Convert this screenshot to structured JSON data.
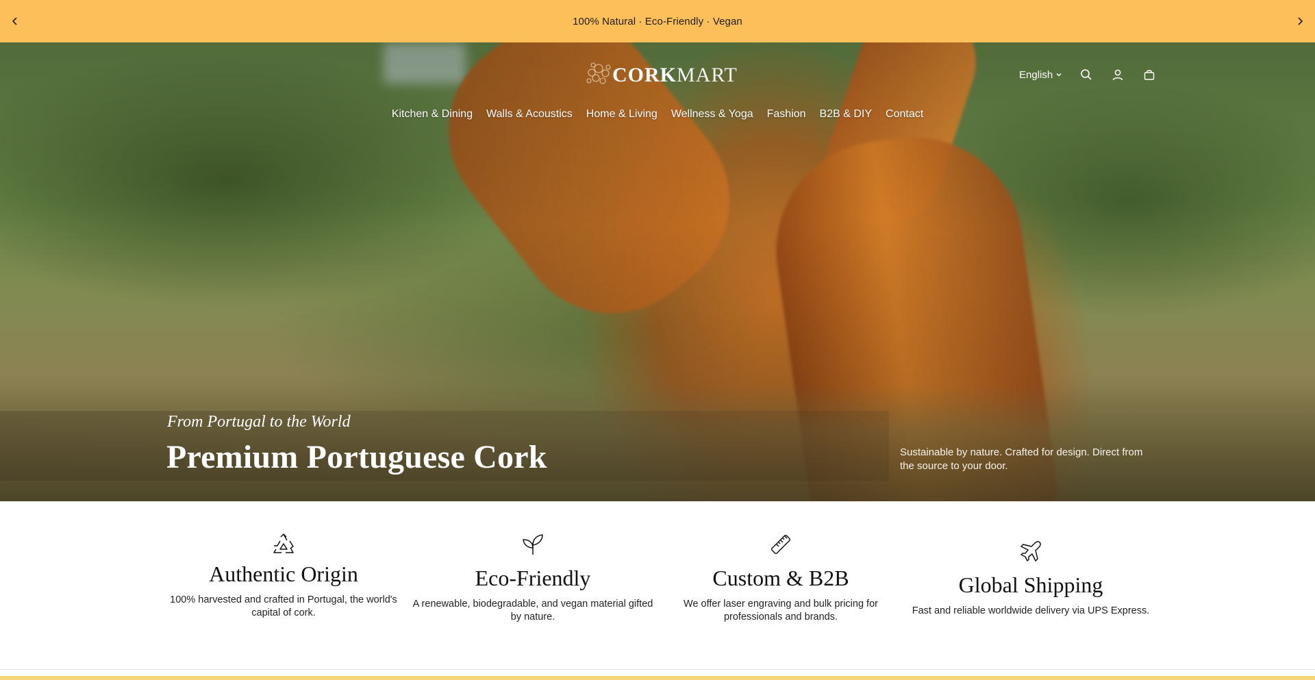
{
  "announcement": {
    "text": "100% Natural · Eco-Friendly · Vegan",
    "prev_icon": "chevron-left-icon",
    "next_icon": "chevron-right-icon",
    "bg_color": "#fdbf5a"
  },
  "header": {
    "logo_bold": "CORK",
    "logo_light": "MART",
    "language": "English",
    "icons": [
      "search-icon",
      "account-icon",
      "cart-icon"
    ]
  },
  "nav": {
    "items": [
      {
        "label": "Kitchen & Dining"
      },
      {
        "label": "Walls & Acoustics"
      },
      {
        "label": "Home & Living"
      },
      {
        "label": "Wellness & Yoga"
      },
      {
        "label": "Fashion"
      },
      {
        "label": "B2B & DIY"
      },
      {
        "label": "Contact"
      }
    ]
  },
  "hero": {
    "kicker": "From Portugal to the World",
    "title": "Premium Portuguese Cork",
    "description": "Sustainable by nature. Crafted for design. Direct from the source to your door."
  },
  "features": [
    {
      "icon": "recycle-icon",
      "title": "Authentic Origin",
      "text": "100% harvested and crafted in Portugal, the world's capital of cork."
    },
    {
      "icon": "sprout-icon",
      "title": "Eco-Friendly",
      "text": "A renewable, biodegradable, and vegan material gifted by nature."
    },
    {
      "icon": "ruler-icon",
      "title": "Custom & B2B",
      "text": "We offer laser engraving and bulk pricing for professionals and brands."
    },
    {
      "icon": "airplane-icon",
      "title": "Global Shipping",
      "text": "Fast and reliable worldwide delivery via UPS Express."
    }
  ]
}
